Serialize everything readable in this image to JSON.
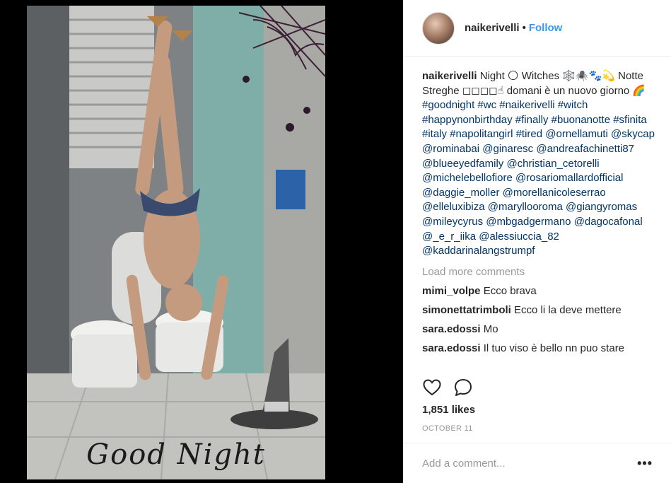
{
  "post": {
    "owner": "naikerivelli",
    "follow_label": "Follow",
    "image_caption": "Good Night",
    "caption": {
      "username": "naikerivelli",
      "text": "Night 🌕 Witches 🕸️🕷️🐾💫 Notte Streghe ◻◻◻◻☝ domani è un nuovo giorno 🌈 ",
      "tags": "#goodnight #wc #naikerivelli #witch #happynonbirthday #finally #buonanotte #sfinita #italy #napolitangirl #tired @ornellamuti @skycap @rominabai @ginaresc @andreafachinetti87 @blueeyedfamily @christian_cetorelli @michelebellofiore @rosariomallardofficial @daggie_moller @morellanicoleserrao @elleluxibiza @maryllooroma @giangyromas @mileycyrus @mbgadgermano @dagocafonal @_e_r_iika @alessiuccia_82 @kaddarinalangstrumpf"
    },
    "load_more_label": "Load more comments",
    "comments": [
      {
        "username": "mimi_volpe",
        "text": "Ecco brava"
      },
      {
        "username": "simonettatrimboli",
        "text": "Ecco li la deve mettere"
      },
      {
        "username": "sara.edossi",
        "text": "Mo"
      },
      {
        "username": "sara.edossi",
        "text": "Il tuo viso è bello nn puo stare"
      }
    ],
    "likes": "1,851 likes",
    "date": "OCTOBER 11",
    "add_comment_placeholder": "Add a comment...",
    "more_label": "•••"
  },
  "icons": {
    "like": "heart-icon",
    "comment": "speech-bubble-icon",
    "more": "more-options-icon"
  },
  "colors": {
    "follow": "#3897f0",
    "hashtag": "#003569",
    "muted": "#999999"
  }
}
